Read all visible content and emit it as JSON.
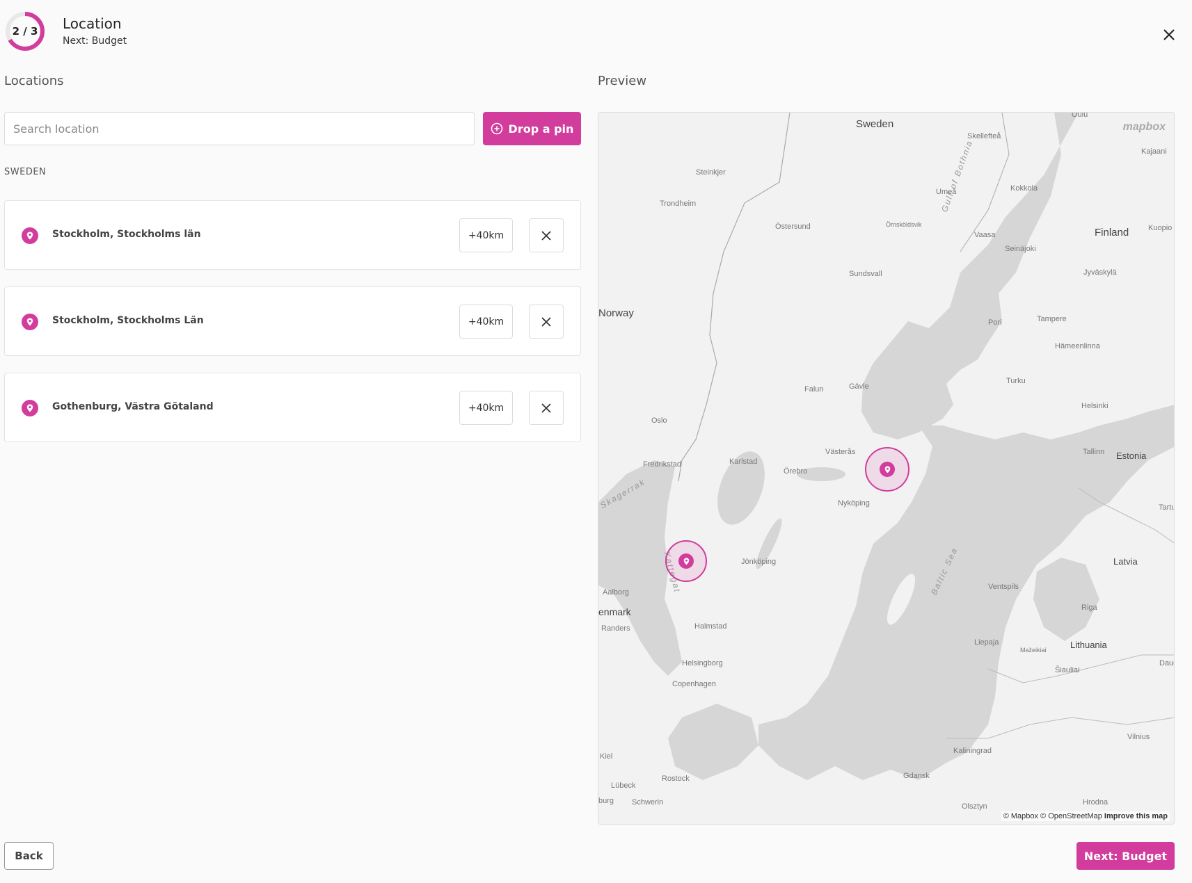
{
  "header": {
    "progress_label": "2 / 3",
    "progress_fraction": 0.667,
    "title": "Location",
    "next_label": "Next: Budget"
  },
  "locations_section": {
    "label": "Locations",
    "search_placeholder": "Search location",
    "drop_pin_label": "Drop a pin",
    "country": "SWEDEN",
    "items": [
      {
        "name": "Stockholm, Stockholms län",
        "radius": "+40km"
      },
      {
        "name": "Stockholm, Stockholms Län",
        "radius": "+40km"
      },
      {
        "name": "Gothenburg, Västra Götaland",
        "radius": "+40km"
      }
    ]
  },
  "preview_section": {
    "label": "Preview",
    "map": {
      "logo": "mapbox",
      "attribution": "© Mapbox © OpenStreetMap",
      "improve_link": "Improve this map",
      "labels": {
        "sweden": "Sweden",
        "norway": "Norway",
        "finland": "Finland",
        "estonia": "Estonia",
        "latvia": "Latvia",
        "lithuania": "Lithuania",
        "denmark": "enmark",
        "gulf": "Gulf of Bothnia",
        "baltic": "Baltic Sea",
        "kattegat": "Kattegat",
        "skagerrak": "Skagerrak",
        "oulu": "Oulu",
        "skelleftea": "Skellefteå",
        "kajaani": "Kajaani",
        "steinkjer": "Steinkjer",
        "trondheim": "Trondheim",
        "umea": "Umeå",
        "kokkola": "Kokkola",
        "ornskoldsvik": "Örnsköldsvik",
        "ostersund": "Östersund",
        "vaasa": "Vaasa",
        "kuopio": "Kuopio",
        "seinajoki": "Seinäjoki",
        "jyvaskyla": "Jyväskylä",
        "sundsvall": "Sundsvall",
        "pori": "Pori",
        "tampere": "Tampere",
        "hameenlinna": "Hämeenlinna",
        "falun": "Falun",
        "gavle": "Gävle",
        "turku": "Turku",
        "helsinki": "Helsinki",
        "oslo": "Oslo",
        "tallinn": "Tallinn",
        "vasteras": "Västerås",
        "fredrikstad": "Fredrikstad",
        "karlstad": "Karlstad",
        "orebro": "Örebro",
        "nykoping": "Nyköping",
        "tartu": "Tartu",
        "jonkoping": "Jönköping",
        "aalborg": "Aalborg",
        "ventspils": "Ventspils",
        "riga": "Riga",
        "randers": "Randers",
        "halmstad": "Halmstad",
        "liepaja": "Liepaja",
        "mazeikiai": "Mažeikiai",
        "siauliai": "Šiauliai",
        "helsingborg": "Helsingborg",
        "copenhagen": "Copenhagen",
        "vilnius": "Vilnius",
        "kaliningrad": "Kaliningrad",
        "kiel": "Kiel",
        "gdansk": "Gdansk",
        "lubeck": "Lübeck",
        "rostock": "Rostock",
        "burg": "burg",
        "schwerin": "Schwerin",
        "olsztyn": "Olsztyn",
        "hrodna": "Hrodna",
        "daug": "Daug"
      }
    }
  },
  "footer": {
    "back_label": "Back",
    "next_label": "Next: Budget"
  },
  "colors": {
    "accent": "#d23c9c",
    "water": "#d6d6d6",
    "land": "#f2f2f2"
  }
}
